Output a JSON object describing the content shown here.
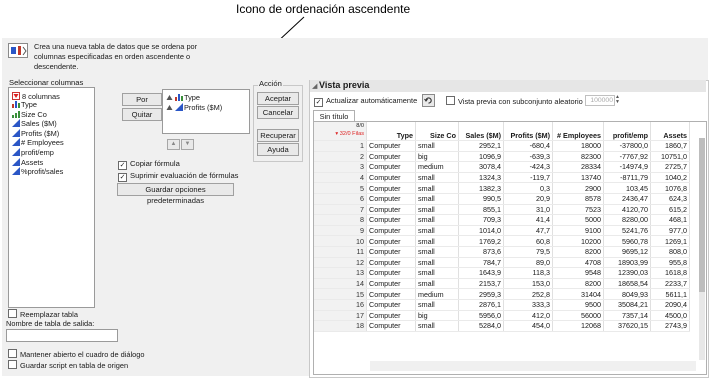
{
  "annotation": {
    "text": "Icono de ordenación ascendente"
  },
  "header": {
    "description": "Crea una nueva tabla de datos que se ordena por columnas especificadas en orden ascendente o descendente."
  },
  "select_columns": {
    "title": "Seleccionar columnas",
    "count": "8 columnas",
    "items": [
      {
        "label": "Type",
        "icon": "nominal-bar-icon",
        "color": "#c0392b"
      },
      {
        "label": "Size Co",
        "icon": "ordinal-bar-icon",
        "color": "#3a8f3a"
      },
      {
        "label": "Sales ($M)",
        "icon": "continuous-triangle-icon",
        "color": "#2a56c6"
      },
      {
        "label": "Profits ($M)",
        "icon": "continuous-triangle-icon",
        "color": "#2a56c6"
      },
      {
        "label": "# Employees",
        "icon": "continuous-triangle-icon",
        "color": "#2a56c6"
      },
      {
        "label": "profit/emp",
        "icon": "continuous-triangle-icon",
        "color": "#2a56c6"
      },
      {
        "label": "Assets",
        "icon": "continuous-triangle-icon",
        "color": "#2a56c6"
      },
      {
        "label": "%profit/sales",
        "icon": "continuous-triangle-icon",
        "color": "#2a56c6"
      }
    ]
  },
  "sort": {
    "by_label": "Por",
    "remove_label": "Quitar",
    "items": [
      {
        "label": "Type",
        "icon": "nominal-bar-icon",
        "direction": "ascending"
      },
      {
        "label": "Profits ($M)",
        "icon": "continuous-triangle-icon",
        "direction": "ascending"
      }
    ],
    "ascending_icon": "sort-ascending-icon",
    "descending_icon": "sort-descending-icon"
  },
  "options": {
    "copy_formula": {
      "label": "Copiar fórmula",
      "checked": true
    },
    "suppress_formula": {
      "label": "Suprimir evaluación de fórmulas",
      "checked": true
    },
    "save_defaults": "Guardar opciones predeterminadas"
  },
  "action": {
    "title": "Acción",
    "ok": "Aceptar",
    "cancel": "Cancelar",
    "recall": "Recuperar",
    "help": "Ayuda"
  },
  "bottom": {
    "replace_table": {
      "label": "Reemplazar tabla",
      "checked": false
    },
    "output_name_label": "Nombre de tabla de salida:",
    "output_name_value": "",
    "keep_open": {
      "label": "Mantener abierto el cuadro de diálogo",
      "checked": false
    },
    "save_script": {
      "label": "Guardar script en tabla de origen",
      "checked": false
    }
  },
  "preview": {
    "title": "Vista previa",
    "auto_update": {
      "label": "Actualizar automáticamente",
      "checked": true
    },
    "subset": {
      "label": "Vista previa con subconjunto aleatorio",
      "checked": false,
      "value": "100000"
    },
    "tab": "Sin título",
    "cols_count": "8/0",
    "rows_count": "32/0 Filas",
    "columns": [
      "Type",
      "Size Co",
      "Sales ($M)",
      "Profits ($M)",
      "# Employees",
      "profit/emp",
      "Assets"
    ],
    "rows": [
      [
        "1",
        "Computer",
        "small",
        "2952,1",
        "-680,4",
        "18000",
        "-37800,0",
        "1860,7"
      ],
      [
        "2",
        "Computer",
        "big",
        "1096,9",
        "-639,3",
        "82300",
        "-7767,92",
        "10751,0"
      ],
      [
        "3",
        "Computer",
        "medium",
        "3078,4",
        "-424,3",
        "28334",
        "-14974,9",
        "2725,7"
      ],
      [
        "4",
        "Computer",
        "small",
        "1324,3",
        "-119,7",
        "13740",
        "-8711,79",
        "1040,2"
      ],
      [
        "5",
        "Computer",
        "small",
        "1382,3",
        "0,3",
        "2900",
        "103,45",
        "1076,8"
      ],
      [
        "6",
        "Computer",
        "small",
        "990,5",
        "20,9",
        "8578",
        "2436,47",
        "624,3"
      ],
      [
        "7",
        "Computer",
        "small",
        "855,1",
        "31,0",
        "7523",
        "4120,70",
        "615,2"
      ],
      [
        "8",
        "Computer",
        "small",
        "709,3",
        "41,4",
        "5000",
        "8280,00",
        "468,1"
      ],
      [
        "9",
        "Computer",
        "small",
        "1014,0",
        "47,7",
        "9100",
        "5241,76",
        "977,0"
      ],
      [
        "10",
        "Computer",
        "small",
        "1769,2",
        "60,8",
        "10200",
        "5960,78",
        "1269,1"
      ],
      [
        "11",
        "Computer",
        "small",
        "873,6",
        "79,5",
        "8200",
        "9695,12",
        "808,0"
      ],
      [
        "12",
        "Computer",
        "small",
        "784,7",
        "89,0",
        "4708",
        "18903,99",
        "955,8"
      ],
      [
        "13",
        "Computer",
        "small",
        "1643,9",
        "118,3",
        "9548",
        "12390,03",
        "1618,8"
      ],
      [
        "14",
        "Computer",
        "small",
        "2153,7",
        "153,0",
        "8200",
        "18658,54",
        "2233,7"
      ],
      [
        "15",
        "Computer",
        "medium",
        "2959,3",
        "252,8",
        "31404",
        "8049,93",
        "5611,1"
      ],
      [
        "16",
        "Computer",
        "small",
        "2876,1",
        "333,3",
        "9500",
        "35084,21",
        "2090,4"
      ],
      [
        "17",
        "Computer",
        "big",
        "5956,0",
        "412,0",
        "56000",
        "7357,14",
        "4500,0"
      ],
      [
        "18",
        "Computer",
        "small",
        "5284,0",
        "454,0",
        "12068",
        "37620,15",
        "2743,9"
      ]
    ]
  }
}
